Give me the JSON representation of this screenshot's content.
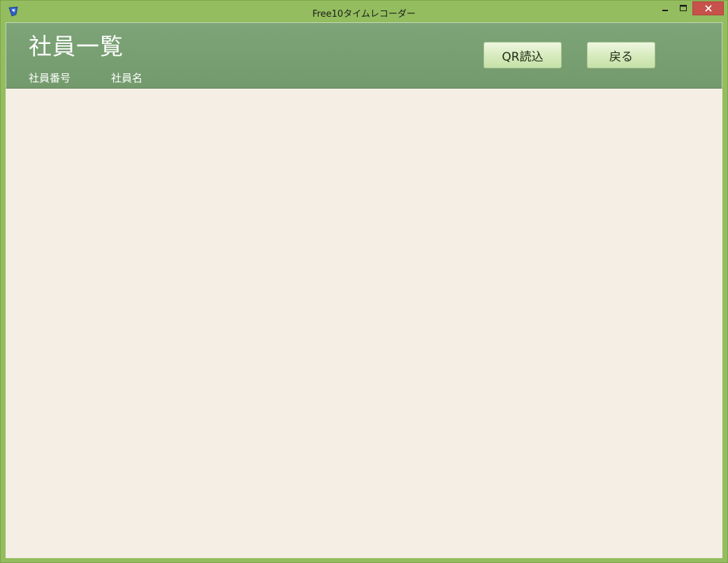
{
  "window": {
    "title": "Free10タイムレコーダー"
  },
  "header": {
    "title": "社員一覧",
    "columns": [
      "社員番号",
      "社員名"
    ]
  },
  "buttons": {
    "qr_label": "QR読込",
    "back_label": "戻る"
  },
  "icons": {
    "app": "app-icon",
    "minimize": "minimize-icon",
    "maximize": "maximize-icon",
    "close": "close-icon"
  },
  "colors": {
    "window_frame": "#93bd5e",
    "header_bg": "#7da478",
    "content_bg": "#f5eee4",
    "button_bg": "#d5eabc",
    "close_button": "#c7514b"
  }
}
